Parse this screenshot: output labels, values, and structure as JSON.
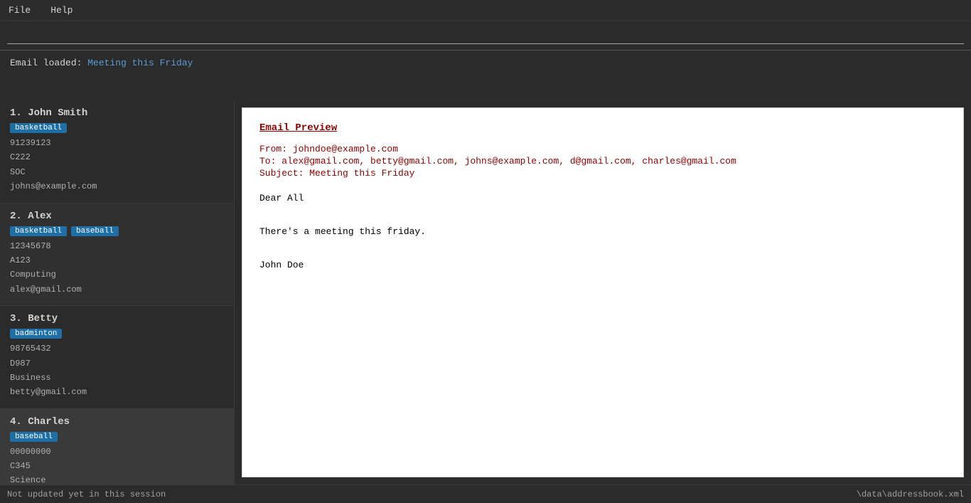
{
  "menu": {
    "file_label": "File",
    "help_label": "Help"
  },
  "search": {
    "placeholder": "",
    "current_value": ""
  },
  "status": {
    "prefix": "Email loaded: ",
    "email_subject": "Meeting this Friday"
  },
  "contacts": [
    {
      "index": "1.",
      "name": "John Smith",
      "tags": [
        "basketball"
      ],
      "phone": "91239123",
      "room": "C222",
      "department": "SOC",
      "email": "johns@example.com"
    },
    {
      "index": "2.",
      "name": "Alex",
      "tags": [
        "basketball",
        "baseball"
      ],
      "phone": "12345678",
      "room": "A123",
      "department": "Computing",
      "email": "alex@gmail.com"
    },
    {
      "index": "3.",
      "name": "Betty",
      "tags": [
        "badminton"
      ],
      "phone": "98765432",
      "room": "D987",
      "department": "Business",
      "email": "betty@gmail.com"
    },
    {
      "index": "4.",
      "name": "Charles",
      "tags": [
        "baseball"
      ],
      "phone": "00000000",
      "room": "C345",
      "department": "Science",
      "email": ""
    }
  ],
  "email_preview": {
    "title": "Email Preview",
    "from": "From: johndoe@example.com",
    "to": "To: alex@gmail.com, betty@gmail.com, johns@example.com, d@gmail.com, charles@gmail.com",
    "subject": "Subject: Meeting this Friday",
    "greeting": "Dear All",
    "body": "There's a meeting this friday.",
    "signature": "John Doe"
  },
  "bottom_bar": {
    "left": "Not updated yet in this session",
    "right": "\\data\\addressbook.xml"
  }
}
